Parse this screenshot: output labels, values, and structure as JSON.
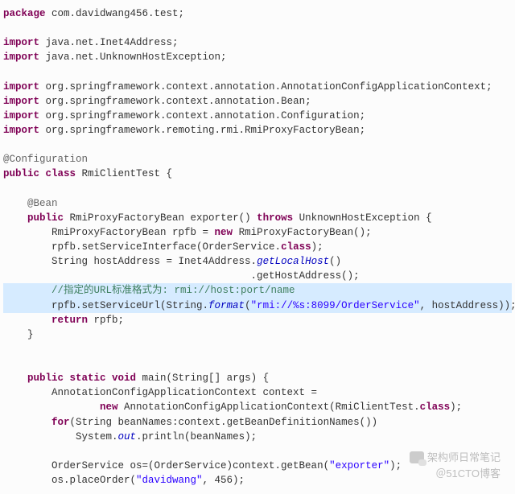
{
  "code": {
    "l1_kw": "package",
    "l1": " com.davidwang456.test;",
    "l3_kw": "import",
    "l3": " java.net.Inet4Address;",
    "l4_kw": "import",
    "l4": " java.net.UnknownHostException;",
    "l6_kw": "import",
    "l6": " org.springframework.context.annotation.AnnotationConfigApplicationContext;",
    "l7_kw": "import",
    "l7": " org.springframework.context.annotation.Bean;",
    "l8_kw": "import",
    "l8": " org.springframework.context.annotation.Configuration;",
    "l9_kw": "import",
    "l9": " org.springframework.remoting.rmi.RmiProxyFactoryBean;",
    "l11_ann": "@Configuration",
    "l12_a": "public class",
    "l12_b": " RmiClientTest {",
    "l14_ann": "    @Bean",
    "l15_a": "    ",
    "l15_b": "public",
    "l15_c": " RmiProxyFactoryBean exporter() ",
    "l15_d": "throws",
    "l15_e": " UnknownHostException {",
    "l16_a": "        RmiProxyFactoryBean rpfb = ",
    "l16_b": "new",
    "l16_c": " RmiProxyFactoryBean();",
    "l17_a": "        rpfb.setServiceInterface(OrderService.",
    "l17_b": "class",
    "l17_c": ");",
    "l18_a": "        String hostAddress = Inet4Address.",
    "l18_b": "getLocalHost",
    "l18_c": "()",
    "l19": "                                         .getHostAddress();",
    "l20_com": "        //指定的URL标准格式为: rmi://host:port/name",
    "l21_a": "        rpfb.setServiceUrl(String.",
    "l21_b": "format",
    "l21_c": "(",
    "l21_d": "\"rmi://%s:8099/OrderService\"",
    "l21_e": ", hostAddress));",
    "l22_a": "        ",
    "l22_b": "return",
    "l22_c": " rpfb;",
    "l23": "    }",
    "l26_a": "    ",
    "l26_b": "public static void",
    "l26_c": " main(String[] args) {",
    "l27": "        AnnotationConfigApplicationContext context =",
    "l28_a": "                ",
    "l28_b": "new",
    "l28_c": " AnnotationConfigApplicationContext(RmiClientTest.",
    "l28_d": "class",
    "l28_e": ");",
    "l29_a": "        ",
    "l29_b": "for",
    "l29_c": "(String beanNames:context.getBeanDefinitionNames())",
    "l30_a": "            System.",
    "l30_b": "out",
    "l30_c": ".println(beanNames);",
    "l32_a": "        OrderService os=(OrderService)context.getBean(",
    "l32_b": "\"exporter\"",
    "l32_c": ");",
    "l33_a": "        os.placeOrder(",
    "l33_b": "\"davidwang\"",
    "l33_c": ", 456);"
  },
  "watermark": {
    "line1": "架构师日常笔记",
    "line2": "＠51CTO博客"
  }
}
